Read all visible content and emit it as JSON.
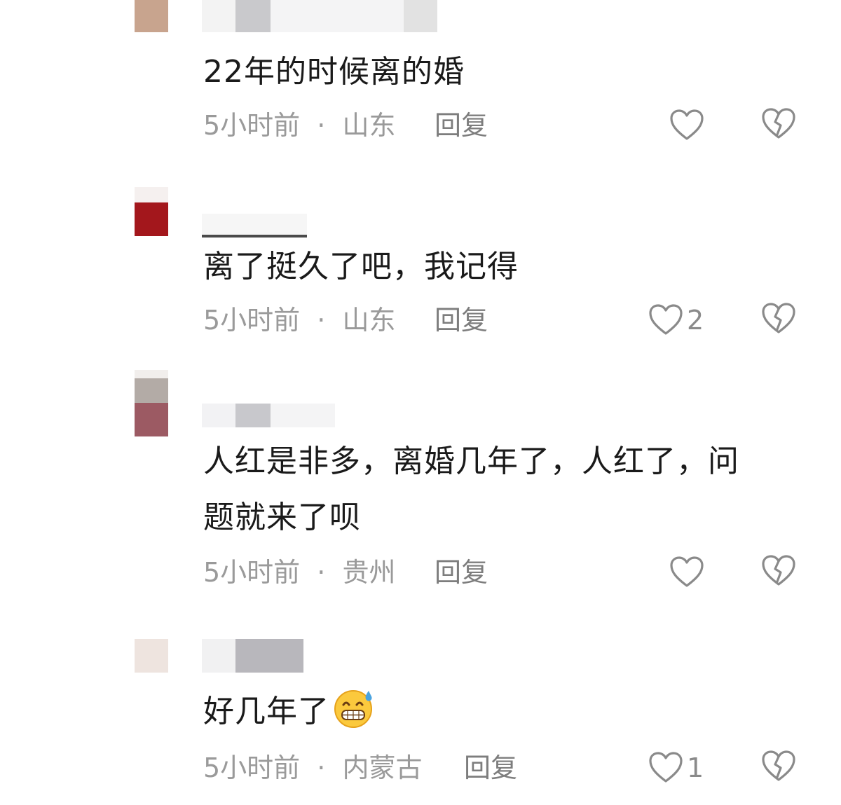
{
  "comments": [
    {
      "text": "22年的时候离的婚",
      "time": "5小时前",
      "location": "山东",
      "reply_label": "回复",
      "like_count": ""
    },
    {
      "text": "离了挺久了吧，我记得",
      "time": "5小时前",
      "location": "山东",
      "reply_label": "回复",
      "like_count": "2"
    },
    {
      "text_line1": "人红是非多，离婚几年了，人红了，问",
      "text_line2": "题就来了呗",
      "time": "5小时前",
      "location": "贵州",
      "reply_label": "回复",
      "like_count": ""
    },
    {
      "text": "好几年了",
      "emoji": "grinning-sweat-emoji",
      "time": "5小时前",
      "location": "内蒙古",
      "reply_label": "回复",
      "like_count": "1"
    }
  ],
  "separator": "·",
  "icons": {
    "like": "heart-outline-icon",
    "dislike": "broken-heart-icon"
  },
  "colors": {
    "text": "#1a1a1a",
    "meta": "#9a9a9a",
    "icon": "#8a8a8a"
  }
}
